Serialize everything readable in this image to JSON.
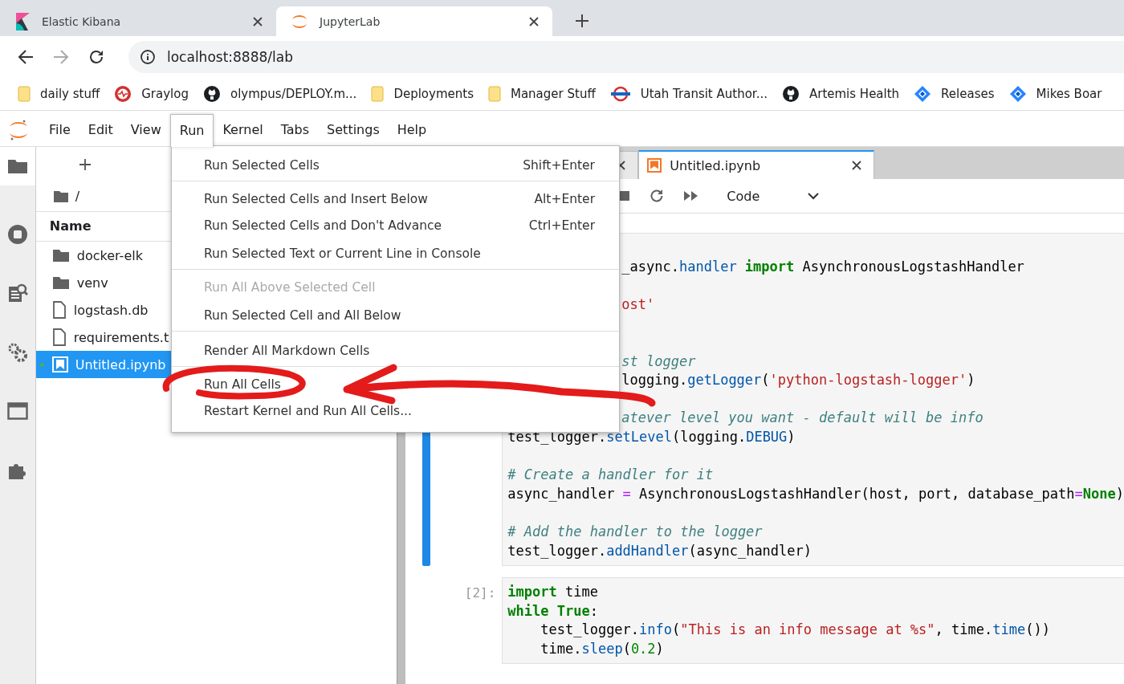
{
  "browser": {
    "tabs": [
      {
        "title": "Elastic Kibana",
        "kind": "kibana",
        "selected": false
      },
      {
        "title": "JupyterLab",
        "kind": "jupyter",
        "selected": true
      }
    ],
    "url": "localhost:8888/lab",
    "bookmarks": [
      {
        "label": "daily stuff",
        "kind": "folder"
      },
      {
        "label": "Graylog",
        "kind": "graylog"
      },
      {
        "label": "olympus/DEPLOY.m...",
        "kind": "github"
      },
      {
        "label": "Deployments",
        "kind": "folder"
      },
      {
        "label": "Manager Stuff",
        "kind": "folder"
      },
      {
        "label": "Utah Transit Author...",
        "kind": "transit"
      },
      {
        "label": "Artemis Health",
        "kind": "github"
      },
      {
        "label": "Releases",
        "kind": "jira"
      },
      {
        "label": "Mikes Boar",
        "kind": "jira"
      }
    ]
  },
  "menubar": [
    {
      "label": "File",
      "selected": false
    },
    {
      "label": "Edit",
      "selected": false
    },
    {
      "label": "View",
      "selected": false
    },
    {
      "label": "Run",
      "selected": true
    },
    {
      "label": "Kernel",
      "selected": false
    },
    {
      "label": "Tabs",
      "selected": false
    },
    {
      "label": "Settings",
      "selected": false
    },
    {
      "label": "Help",
      "selected": false
    }
  ],
  "sidebar_icons": [
    {
      "kind": "folder",
      "selected": true
    },
    {
      "kind": "stop",
      "selected": false
    },
    {
      "kind": "inspector",
      "selected": false
    },
    {
      "kind": "gears",
      "selected": false
    },
    {
      "kind": "tabs",
      "selected": false
    },
    {
      "kind": "puzzle",
      "selected": false
    }
  ],
  "file_browser": {
    "path": "/",
    "column": "Name",
    "items": [
      {
        "name": "docker-elk",
        "kind": "folder",
        "selected": false,
        "running": false
      },
      {
        "name": "venv",
        "kind": "folder",
        "selected": false,
        "running": false
      },
      {
        "name": "logstash.db",
        "kind": "file",
        "selected": false,
        "running": false
      },
      {
        "name": "requirements.t",
        "kind": "file",
        "selected": false,
        "running": false
      },
      {
        "name": "Untitled.ipynb",
        "kind": "notebook",
        "selected": true,
        "running": true
      }
    ]
  },
  "run_menu": [
    {
      "label": "Run Selected Cells",
      "shortcut": "Shift+Enter",
      "disabled": false,
      "separator_after": true
    },
    {
      "label": "Run Selected Cells and Insert Below",
      "shortcut": "Alt+Enter",
      "disabled": false,
      "separator_after": false
    },
    {
      "label": "Run Selected Cells and Don't Advance",
      "shortcut": "Ctrl+Enter",
      "disabled": false,
      "separator_after": false
    },
    {
      "label": "Run Selected Text or Current Line in Console",
      "disabled": false,
      "separator_after": true
    },
    {
      "label": "Run All Above Selected Cell",
      "disabled": true,
      "separator_after": false
    },
    {
      "label": "Run Selected Cell and All Below",
      "disabled": false,
      "separator_after": true
    },
    {
      "label": "Render All Markdown Cells",
      "disabled": false,
      "separator_after": true
    },
    {
      "label": "Run All Cells",
      "disabled": false,
      "separator_after": false
    },
    {
      "label": "Restart Kernel and Run All Cells...",
      "disabled": false,
      "separator_after": false
    }
  ],
  "notebook_tabs": [
    {
      "selected": false
    },
    {
      "label": "Untitled.ipynb",
      "selected": true
    }
  ],
  "toolbar": {
    "cell_type": "Code"
  },
  "cells": [
    {
      "selected": true,
      "lines": [
        {
          "kind": "blank"
        },
        {
          "kind": "clipped",
          "tokens": [
            {
              "text": "_async.",
              "kind": "plain"
            },
            {
              "text": "handler",
              "kind": "name"
            },
            {
              "text": " import",
              "kind": "keyword"
            },
            {
              "text": " AsynchronousLogstashHandler",
              "kind": "plain"
            }
          ]
        },
        {
          "kind": "blank"
        },
        {
          "kind": "clipped",
          "tokens": [
            {
              "text": "ost'",
              "kind": "string"
            }
          ]
        },
        {
          "kind": "blank"
        },
        {
          "kind": "blank"
        },
        {
          "kind": "clipped",
          "tokens": [
            {
              "text": "st logger",
              "kind": "comment"
            }
          ]
        },
        {
          "kind": "clipped",
          "tokens": [
            {
              "text": "logging.",
              "kind": "plain"
            },
            {
              "text": "getLogger",
              "kind": "name"
            },
            {
              "text": "(",
              "kind": "plain"
            },
            {
              "text": "'python-logstash-logger'",
              "kind": "string"
            },
            {
              "text": ")",
              "kind": "plain"
            }
          ]
        },
        {
          "kind": "blank"
        },
        {
          "kind": "clipped",
          "tokens": [
            {
              "text": "atever level you want - default will be info",
              "kind": "comment"
            }
          ]
        },
        {
          "kind": "code",
          "tokens": [
            {
              "text": "test_logger.",
              "kind": "plain"
            },
            {
              "text": "setLevel",
              "kind": "name"
            },
            {
              "text": "(logging.",
              "kind": "plain"
            },
            {
              "text": "DEBUG",
              "kind": "name"
            },
            {
              "text": ")",
              "kind": "plain"
            }
          ]
        },
        {
          "kind": "blank"
        },
        {
          "kind": "code",
          "tokens": [
            {
              "text": "# Create a handler for it",
              "kind": "comment"
            }
          ]
        },
        {
          "kind": "code",
          "tokens": [
            {
              "text": "async_handler ",
              "kind": "plain"
            },
            {
              "text": "=",
              "kind": "operator"
            },
            {
              "text": " AsynchronousLogstashHandler(host, port, database_path",
              "kind": "plain"
            },
            {
              "text": "=",
              "kind": "operator"
            },
            {
              "text": "None",
              "kind": "keyword"
            },
            {
              "text": ")",
              "kind": "plain"
            }
          ]
        },
        {
          "kind": "blank"
        },
        {
          "kind": "code",
          "tokens": [
            {
              "text": "# Add the handler to the logger",
              "kind": "comment"
            }
          ]
        },
        {
          "kind": "code",
          "tokens": [
            {
              "text": "test_logger.",
              "kind": "plain"
            },
            {
              "text": "addHandler",
              "kind": "name"
            },
            {
              "text": "(async_handler)",
              "kind": "plain"
            }
          ]
        }
      ]
    },
    {
      "selected": false,
      "prompt": "[2]:",
      "lines": [
        {
          "kind": "code",
          "tokens": [
            {
              "text": "import",
              "kind": "keyword"
            },
            {
              "text": " time",
              "kind": "plain"
            }
          ]
        },
        {
          "kind": "code",
          "tokens": [
            {
              "text": "while True",
              "kind": "keyword"
            },
            {
              "text": ":",
              "kind": "plain"
            }
          ]
        },
        {
          "kind": "code",
          "tokens": [
            {
              "text": "    test_logger.",
              "kind": "plain"
            },
            {
              "text": "info",
              "kind": "name"
            },
            {
              "text": "(",
              "kind": "plain"
            },
            {
              "text": "\"This is an info message at %s\"",
              "kind": "string"
            },
            {
              "text": ", time.",
              "kind": "plain"
            },
            {
              "text": "time",
              "kind": "name"
            },
            {
              "text": "())",
              "kind": "plain"
            }
          ]
        },
        {
          "kind": "code",
          "tokens": [
            {
              "text": "    time.",
              "kind": "plain"
            },
            {
              "text": "sleep",
              "kind": "name"
            },
            {
              "text": "(",
              "kind": "plain"
            },
            {
              "text": "0.2",
              "kind": "number"
            },
            {
              "text": ")",
              "kind": "plain"
            }
          ]
        }
      ]
    }
  ]
}
